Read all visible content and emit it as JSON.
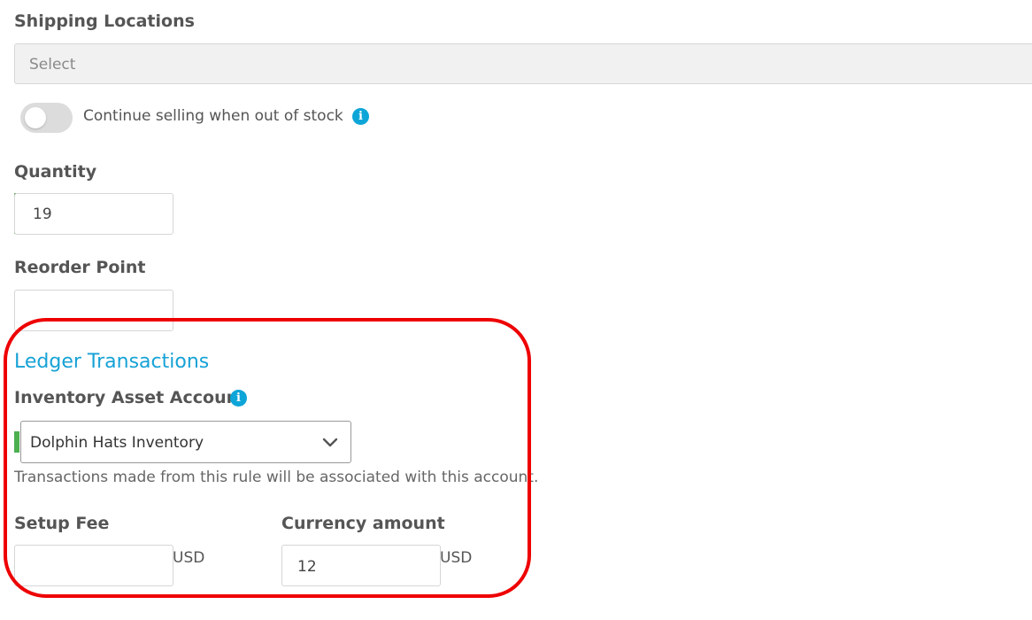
{
  "shipping": {
    "label": "Shipping Locations",
    "placeholder": "Select"
  },
  "continue_selling": {
    "label": "Continue selling when out of stock",
    "enabled": false,
    "info_icon": "info-icon"
  },
  "quantity": {
    "label": "Quantity",
    "value": "19"
  },
  "reorder_point": {
    "label": "Reorder Point",
    "value": ""
  },
  "ledger": {
    "title": "Ledger Transactions",
    "inventory_account": {
      "label": "Inventory Asset Account",
      "info_icon": "info-icon",
      "selected": "Dolphin Hats Inventory",
      "help": "Transactions made from this rule will be associated with this account."
    },
    "setup_fee": {
      "label": "Setup Fee",
      "value": "",
      "unit": "USD"
    },
    "currency_amount": {
      "label": "Currency amount",
      "value": "12",
      "unit": "USD"
    }
  },
  "colors": {
    "accent": "#17a2d6",
    "valid_bar": "#4caf50",
    "highlight": "#ee0000",
    "info_icon": "#0ea5d8"
  }
}
